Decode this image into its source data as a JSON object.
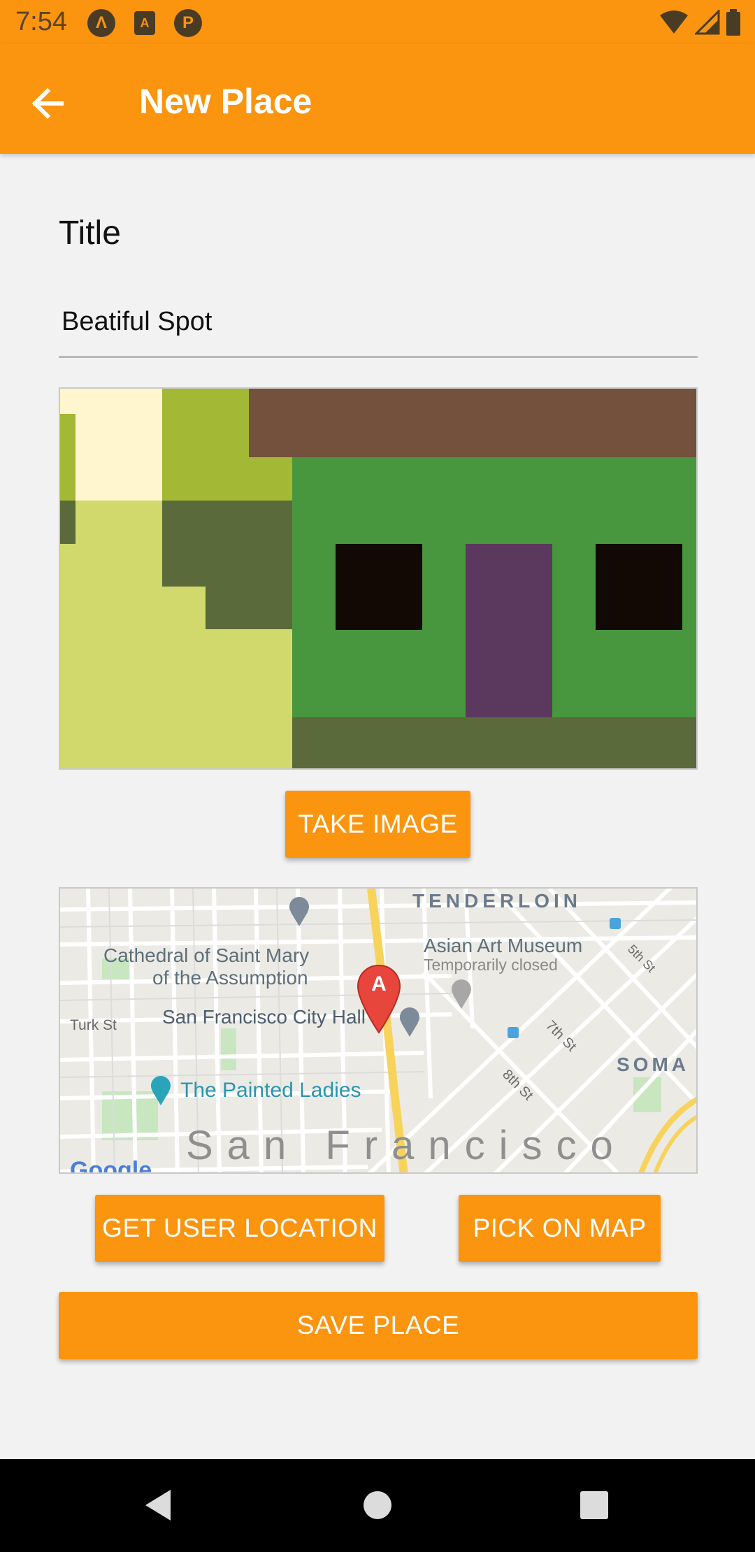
{
  "status_bar": {
    "time": "7:54",
    "icons": [
      "app-a-icon",
      "app-font-icon",
      "app-p-icon"
    ],
    "right_icons": [
      "wifi-icon",
      "signal-icon",
      "battery-icon"
    ]
  },
  "app_bar": {
    "title": "New Place",
    "back_icon": "arrow-left-icon"
  },
  "form": {
    "title_label": "Title",
    "title_value": "Beatiful Spot"
  },
  "buttons": {
    "take_image": "TAKE IMAGE",
    "get_user_location": "GET USER LOCATION",
    "pick_on_map": "PICK ON MAP",
    "save_place": "SAVE PLACE"
  },
  "map": {
    "labels": {
      "tenderloin": "TENDERLOIN",
      "cathedral_1": "Cathedral of Saint Mary",
      "cathedral_2": "of the Assumption",
      "asian_art": "Asian Art Museum",
      "temporarily_closed": "Temporarily closed",
      "fifth_st": "5th St",
      "turk_st": "Turk St",
      "city_hall": "San Francisco City Hall",
      "seventh_st": "7th St",
      "soma": "SOMA",
      "eighth_st": "8th St",
      "painted_ladies": "The Painted Ladies",
      "san_francisco": "San Francisco",
      "google": "Google"
    },
    "marker_letter": "A"
  },
  "nav_bar": {
    "icons": [
      "back-triangle-icon",
      "home-circle-icon",
      "recents-square-icon"
    ]
  },
  "colors": {
    "accent": "#fb940e",
    "background": "#f2f2f2"
  }
}
